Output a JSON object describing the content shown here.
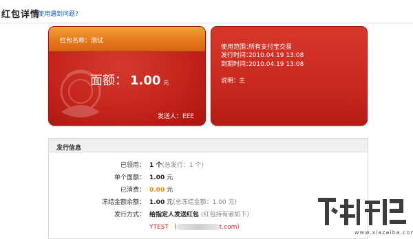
{
  "header": {
    "title": "红包详情",
    "help_link": "使用遇到问题?"
  },
  "card": {
    "name_label": "红包名称：",
    "name_value": "测试",
    "amount_label": "面额：",
    "amount_value": "1.00",
    "amount_unit": "元",
    "sender_label": "发送人：",
    "sender_value": "EEE",
    "accent_color": "#c4241c",
    "band_color": "#e57a1c"
  },
  "card_info": {
    "scope_label": "使用范围：",
    "scope_value": "所有支付宝交易",
    "issue_time_label": "发行时间：",
    "issue_time_value": "2010.04.19 13:08",
    "expire_time_label": "到期时间：",
    "expire_time_value": "2010.04.19 13:08",
    "desc_label": "说明：",
    "desc_value": "主"
  },
  "issue_panel": {
    "title": "发行信息",
    "claimed_label": "已领用：",
    "claimed_value": "1 个",
    "claimed_note": "(总发行：1 个)",
    "unit_amount_label": "单个面额：",
    "unit_amount_value": "1.00",
    "unit_amount_unit": "元",
    "consumed_label": "已消费：",
    "consumed_value": "0.00",
    "consumed_unit": "元",
    "frozen_label": "冻结金额余额：",
    "frozen_value": "1.00",
    "frozen_unit": "元",
    "frozen_note": "(总冻结金额：1.00  元)",
    "method_label": "发行方式：",
    "method_value": "给指定人发送红包",
    "method_note": "(红包持有者如下)",
    "recipient_name": "YTEST",
    "recipient_open": "（",
    "recipient_suffix": "t.com",
    "recipient_close": "）"
  },
  "watermark": {
    "text": "www.xiazaiba.com"
  }
}
